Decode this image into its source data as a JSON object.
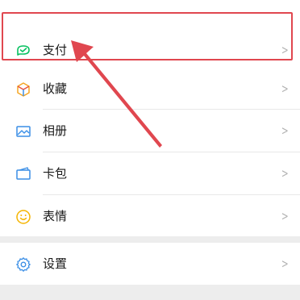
{
  "menu": {
    "items": [
      {
        "label": "支付",
        "icon": "wallet-check-icon",
        "chevron": ">"
      },
      {
        "label": "收藏",
        "icon": "favorites-cube-icon",
        "chevron": ">"
      },
      {
        "label": "相册",
        "icon": "album-picture-icon",
        "chevron": ">"
      },
      {
        "label": "卡包",
        "icon": "card-wallet-icon",
        "chevron": ">"
      },
      {
        "label": "表情",
        "icon": "emoji-smile-icon",
        "chevron": ">"
      }
    ],
    "settings": {
      "label": "设置",
      "icon": "gear-icon",
      "chevron": ">"
    }
  },
  "colors": {
    "pay_green": "#07c160",
    "favorites_orange": "#f5a623",
    "favorites_red": "#e8533f",
    "blue": "#3a8ee6",
    "emoji_yellow": "#f5b400",
    "annotation_red": "#e0474f"
  }
}
